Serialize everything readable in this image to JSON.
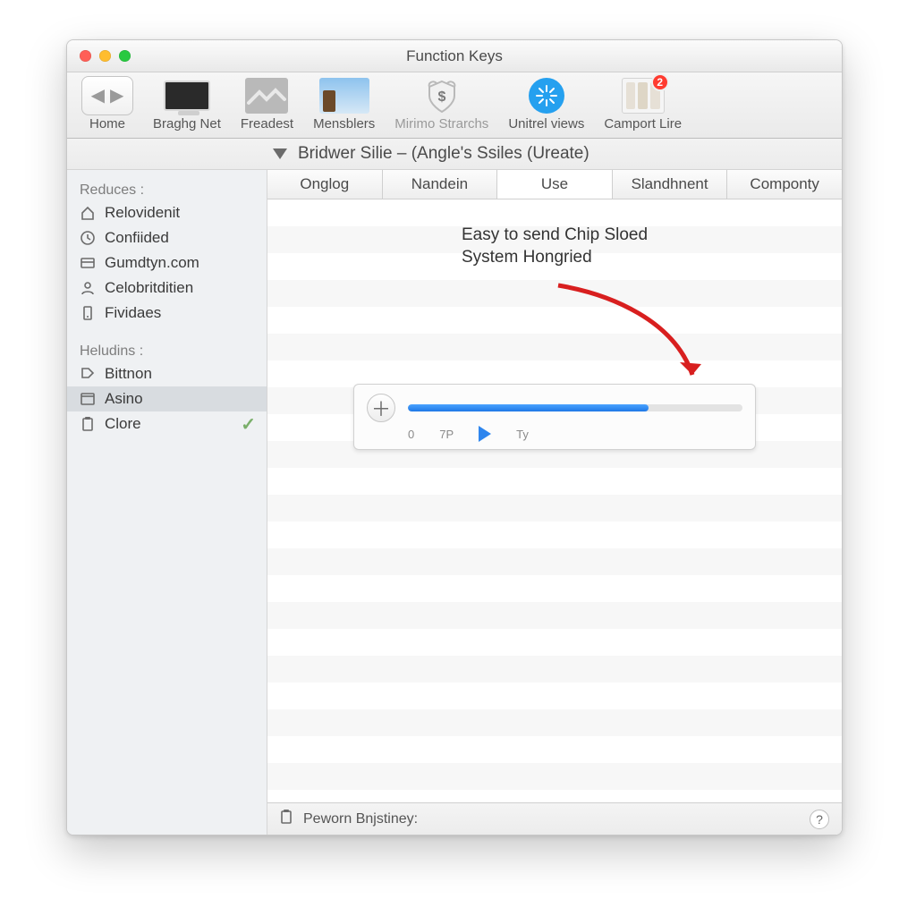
{
  "window": {
    "title": "Function Keys"
  },
  "badge_count": "2",
  "toolbar": [
    {
      "label": "Home"
    },
    {
      "label": "Braghg Net"
    },
    {
      "label": "Freadest"
    },
    {
      "label": "Mensblers"
    },
    {
      "label": "Mirimo Strarchs"
    },
    {
      "label": "Unitrel views"
    },
    {
      "label": "Camport Lire"
    }
  ],
  "subheader": "Bridwer Silie – (Angle's Ssiles (Ureate)",
  "sidebar": {
    "groups": [
      {
        "heading": "Reduces :",
        "items": [
          {
            "label": "Relovidenit"
          },
          {
            "label": "Confiided"
          },
          {
            "label": "Gumdtyn.com"
          },
          {
            "label": "Celobritditien"
          },
          {
            "label": "Fividaes"
          }
        ]
      },
      {
        "heading": "Heludins :",
        "items": [
          {
            "label": "Bittnon"
          },
          {
            "label": "Asino"
          },
          {
            "label": "Clore"
          }
        ]
      }
    ]
  },
  "tabs": [
    "Onglog",
    "Nandein",
    "Use",
    "Slandhnent",
    "Componty"
  ],
  "hint_line1": "Easy to send Chip Sloed",
  "hint_line2": "System Hongried",
  "media": {
    "start": "0",
    "tick": "7P",
    "end_tick": "Ty"
  },
  "footer_label": "Peworn Bnjstiney:"
}
